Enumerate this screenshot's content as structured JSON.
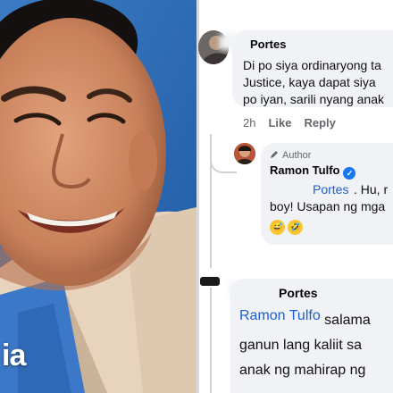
{
  "photo": {
    "watermark": "ia"
  },
  "comments": [
    {
      "name": "Portes",
      "lines": [
        "Di po siya ordinaryong ta",
        "Justice, kaya dapat siya",
        "po iyan, sarili nyang anak"
      ],
      "time": "2h",
      "actions": [
        "Like",
        "Reply"
      ]
    },
    {
      "badge": "Author",
      "name": "Ramon Tulfo",
      "tag": "Portes",
      "line1_rest": ". Hu, r",
      "line2": "boy! Usapan ng mga",
      "emoji": [
        "grinning-sweat-emoji",
        "rolling-laughing-emoji"
      ]
    },
    {
      "name": "Portes",
      "tag": "Ramon Tulfo",
      "line1_rest": " salama",
      "line2": "ganun lang kaliit sa",
      "line3": "anak ng mahirap ng"
    }
  ],
  "colors": {
    "link": "#1c5fd1",
    "bubble": "#f0f2f5",
    "verified": "#1877f2"
  }
}
